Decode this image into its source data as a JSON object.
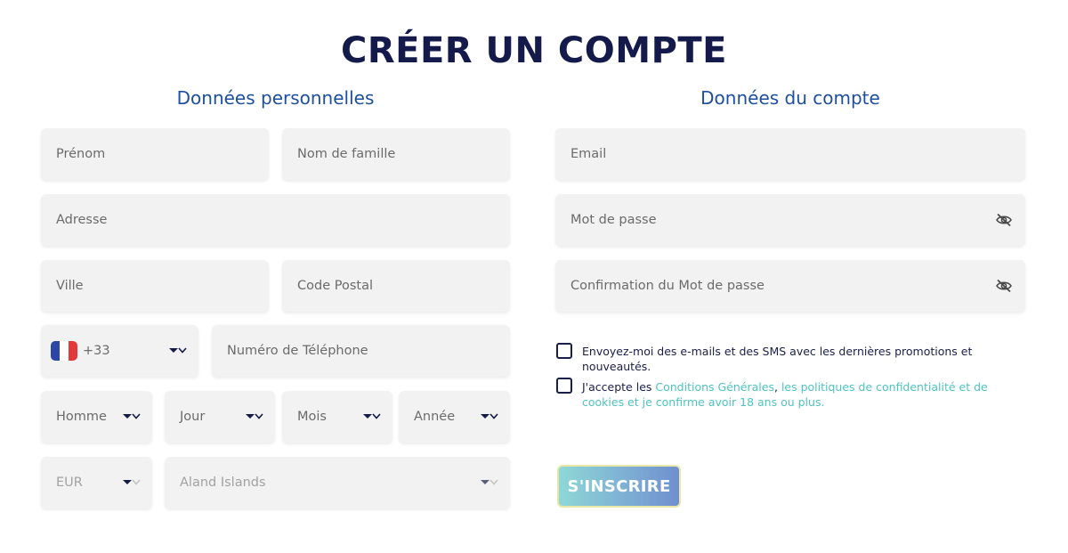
{
  "page": {
    "title": "CRÉER UN COMPTE"
  },
  "personal": {
    "heading": "Données personnelles",
    "first_name_placeholder": "Prénom",
    "last_name_placeholder": "Nom de famille",
    "address_placeholder": "Adresse",
    "city_placeholder": "Ville",
    "postal_code_placeholder": "Code Postal",
    "phone_code": "+33",
    "phone_flag": "france-flag-icon",
    "phone_placeholder": "Numéro de Téléphone",
    "gender_value": "Homme",
    "day_value": "Jour",
    "month_value": "Mois",
    "year_value": "Année",
    "currency_value": "EUR",
    "country_value": "Aland Islands"
  },
  "account": {
    "heading": "Données du compte",
    "email_placeholder": "Email",
    "password_placeholder": "Mot de passe",
    "password_confirm_placeholder": "Confirmation du Mot de passe",
    "password_toggle_icon": "eye-slash-icon"
  },
  "consents": {
    "marketing_label": "Envoyez-moi des e-mails et des SMS avec les dernières promotions et nouveautés.",
    "terms_prefix": "J'accepte les ",
    "terms_link": "Conditions Générales",
    "terms_sep": ", ",
    "privacy_link": "les politiques de confidentialité et de cookies et je confirme avoir 18 ans ou plus."
  },
  "submit": {
    "label": "S'INSCRIRE"
  },
  "colors": {
    "title": "#141a4a",
    "section_heading": "#1d4f9e",
    "field_bg": "#f2f2f2",
    "link": "#4fc3c0",
    "button_start": "#8fd8d6",
    "button_end": "#6f8fd0"
  }
}
